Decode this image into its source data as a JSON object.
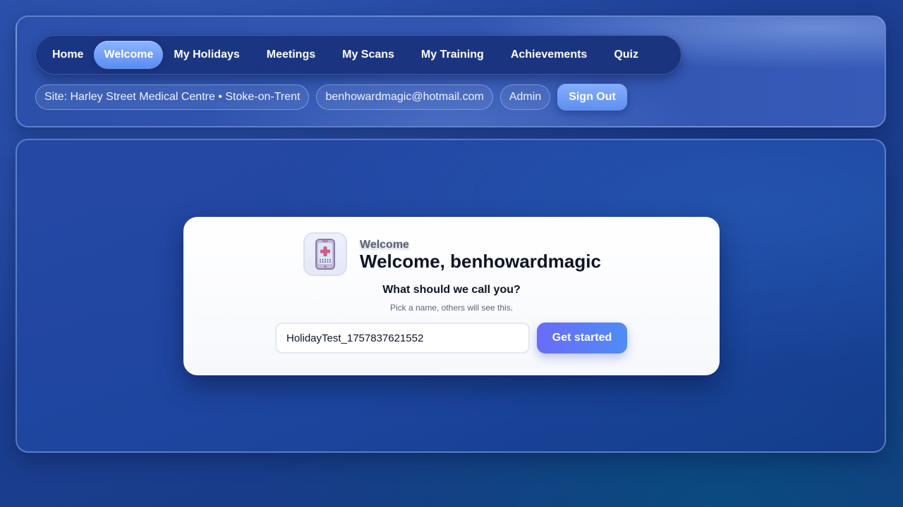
{
  "nav": {
    "items": [
      {
        "label": "Home"
      },
      {
        "label": "Welcome",
        "active": true
      },
      {
        "label": "My Holidays"
      },
      {
        "label": "Meetings"
      },
      {
        "label": "My Scans"
      },
      {
        "label": "My Training"
      },
      {
        "label": "Achievements"
      },
      {
        "label": "Quiz"
      }
    ]
  },
  "user_bar": {
    "site": "Site: Harley Street Medical Centre • Stoke-on-Trent",
    "email": "benhowardmagic@hotmail.com",
    "role": "Admin",
    "sign_out": "Sign Out"
  },
  "welcome_card": {
    "icon": "medical-phone-icon",
    "eyebrow": "Welcome",
    "title": "Welcome, benhowardmagic",
    "question": "What should we call you?",
    "hint": "Pick a name, others will see this.",
    "name_value": "HolidayTest_1757837621552",
    "submit_label": "Get started"
  },
  "colors": {
    "accent": "#5b8cf0",
    "button_gradient_start": "#6a6cf6",
    "button_gradient_end": "#4f8cf6",
    "background": "#1d3f94"
  }
}
